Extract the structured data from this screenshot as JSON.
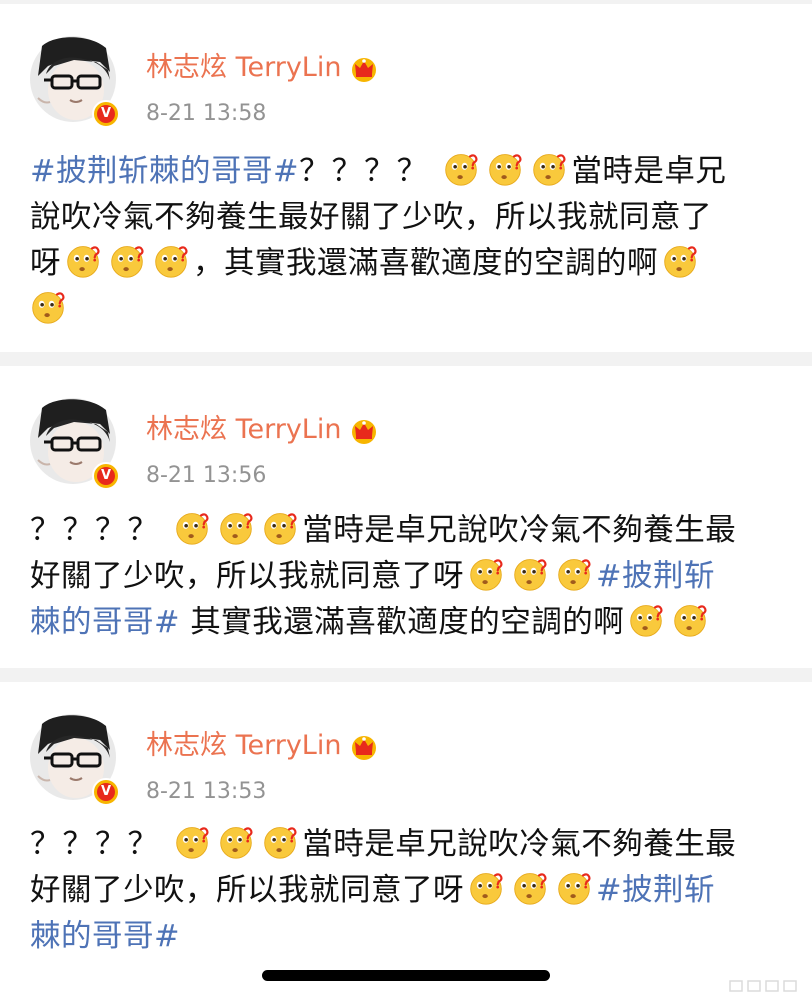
{
  "posts": [
    {
      "user_name": "林志炫 TerryLin",
      "timestamp": "8-21 13:58",
      "lines": [
        {
          "p1": "#披荆斩棘的哥哥#",
          "p2": "？？？？",
          "p3": "當時是卓兄"
        },
        {
          "p1": "說吹冷氣不夠養生最好關了少吹，所以我就同意了"
        },
        {
          "p1": "呀",
          "p2": "，其實我還滿喜歡適度的空調的啊"
        }
      ]
    },
    {
      "user_name": "林志炫 TerryLin",
      "timestamp": "8-21 13:56",
      "lines": [
        {
          "p1": "？？？？",
          "p2": "當時是卓兄說吹冷氣不夠養生最"
        },
        {
          "p1": "好關了少吹，所以我就同意了呀",
          "p2": "#披荆斩"
        },
        {
          "p1": "棘的哥哥#",
          "p2": " 其實我還滿喜歡適度的空調的啊"
        }
      ]
    },
    {
      "user_name": "林志炫 TerryLin",
      "timestamp": "8-21 13:53",
      "lines": [
        {
          "p1": "？？？？",
          "p2": "當時是卓兄說吹冷氣不夠養生最"
        },
        {
          "p1": "好關了少吹，所以我就同意了呀",
          "p2": "#披荆斩"
        },
        {
          "p1": "棘的哥哥#"
        }
      ]
    }
  ],
  "icons": {
    "verified_badge": "verified-badge-icon",
    "crown": "crown-icon",
    "emoji": "thinking-face-emoji-icon"
  },
  "colors": {
    "user_name": "#eb7350",
    "hashtag": "#4e73b6",
    "timestamp": "#939393",
    "verified_badge_outer": "#f7b500",
    "verified_badge_inner": "#e8291c",
    "emoji_face": "#f9c93c"
  }
}
